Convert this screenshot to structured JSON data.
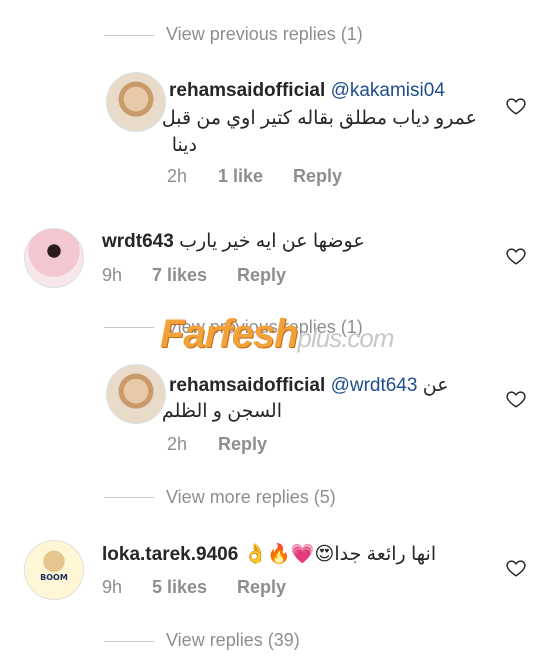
{
  "thread1": {
    "view_previous_replies": "View previous replies (1)",
    "reply": {
      "username": "rehamsaidofficial",
      "mention": "@kakamisi04",
      "text_line1": "عمرو دياب مطلق بقاله كتير اوي من قبل",
      "text_line2": "دينا",
      "time": "2h",
      "likes": "1 like",
      "reply_label": "Reply"
    }
  },
  "comment2": {
    "username": "wrdt643",
    "text": "عوضها عن ايه خير يارب",
    "time": "9h",
    "likes": "7 likes",
    "reply_label": "Reply",
    "view_previous_replies": "View previous replies (1)",
    "reply": {
      "username": "rehamsaidofficial",
      "mention": "@wrdt643",
      "text_line1_end": "عن",
      "text_line2": "السجن و الظلم",
      "time": "2h",
      "reply_label": "Reply"
    },
    "view_more_replies": "View more replies (5)"
  },
  "comment3": {
    "username": "loka.tarek.9406",
    "text": "انها رائعة جدا",
    "emojis": "😍💗🔥👌",
    "time": "9h",
    "likes": "5 likes",
    "reply_label": "Reply",
    "view_replies": "View replies (39)",
    "avatar_text": "BOOM"
  },
  "watermark": {
    "brand": "Farfesh",
    "suffix": "plus.com"
  },
  "colors": {
    "meta": "#8e8e8e",
    "mention": "#1f4e8c",
    "watermark": "#f2a23a"
  }
}
